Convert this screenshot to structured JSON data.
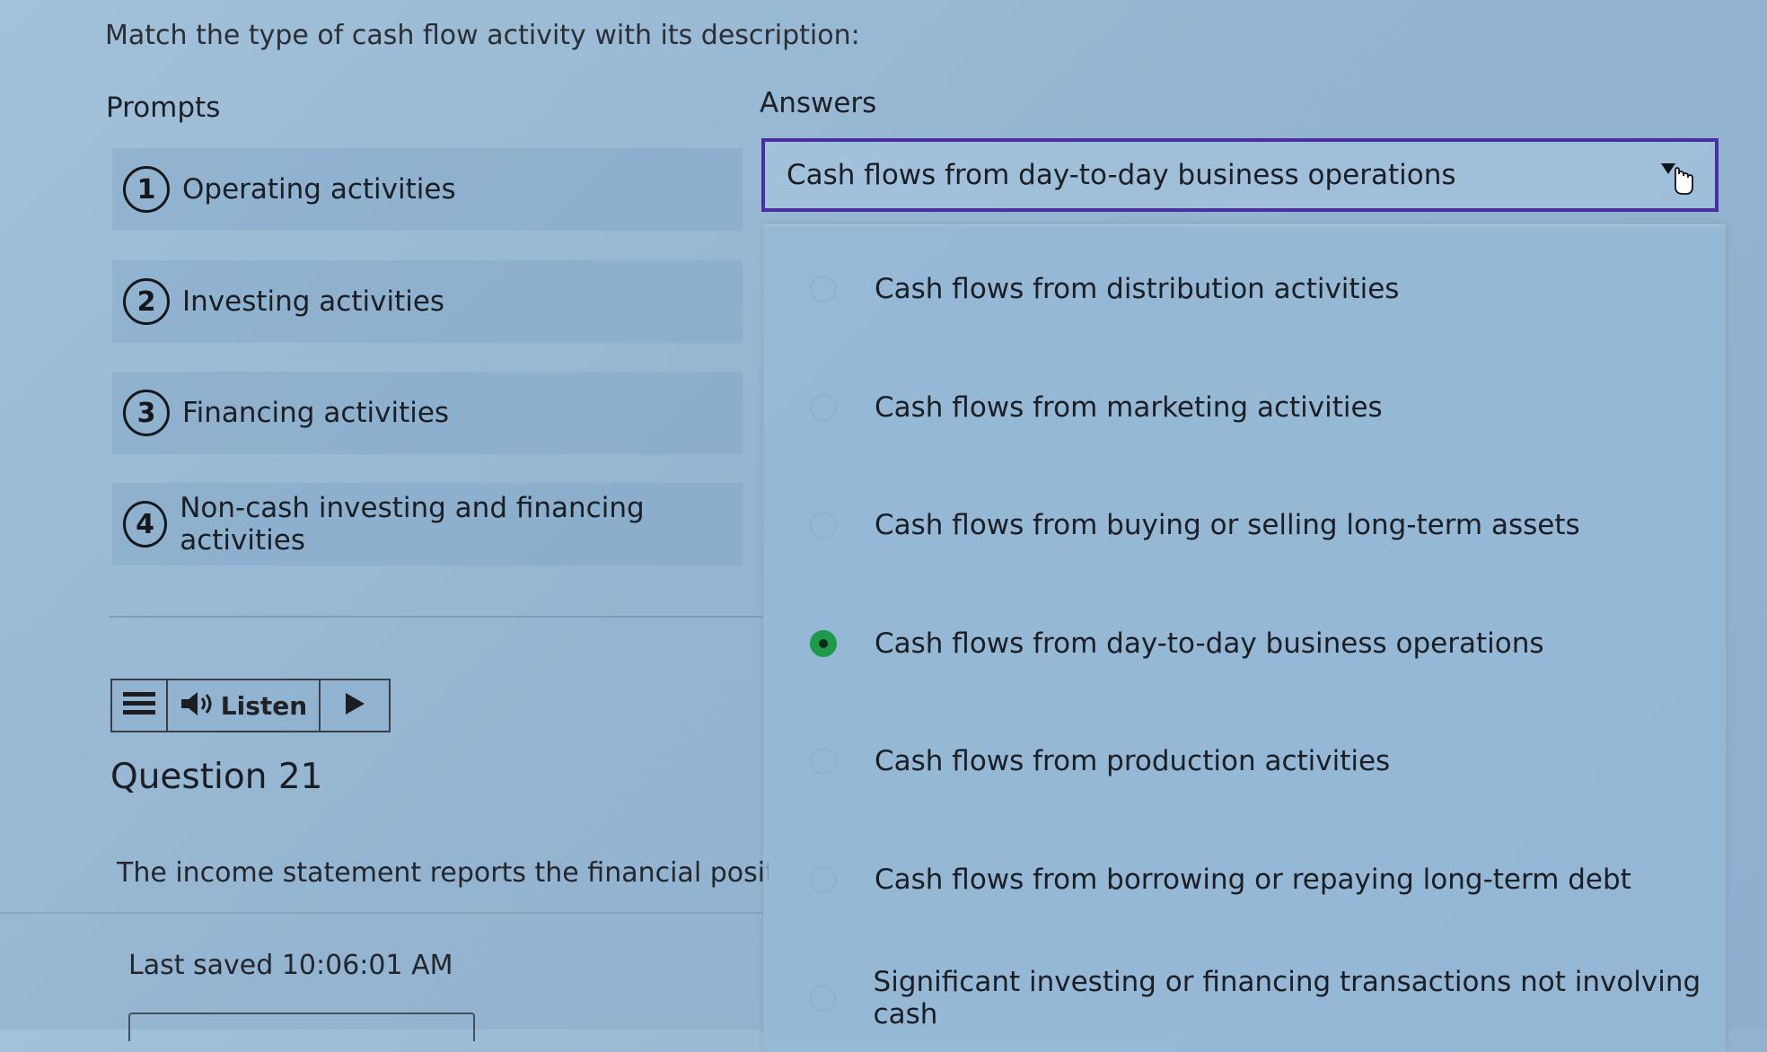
{
  "instruction": "Match the type of cash flow activity with its description:",
  "prompts_heading": "Prompts",
  "answers_heading": "Answers",
  "prompts": [
    {
      "number": "1",
      "label": "Operating activities"
    },
    {
      "number": "2",
      "label": "Investing activities"
    },
    {
      "number": "3",
      "label": "Financing activities"
    },
    {
      "number": "4",
      "label": "Non-cash investing and financing activities"
    }
  ],
  "select": {
    "value": "Cash flows from day-to-day business operations"
  },
  "options": [
    {
      "label": "Cash flows from distribution activities",
      "selected": false
    },
    {
      "label": "Cash flows from marketing activities",
      "selected": false
    },
    {
      "label": "Cash flows from buying or selling long-term assets",
      "selected": false
    },
    {
      "label": "Cash flows from day-to-day business operations",
      "selected": true
    },
    {
      "label": "Cash flows from production activities",
      "selected": false
    },
    {
      "label": "Cash flows from borrowing or repaying long-term debt",
      "selected": false
    },
    {
      "label": "Significant investing or financing transactions not involving cash",
      "selected": false
    }
  ],
  "listen": {
    "label": "Listen"
  },
  "question": {
    "title": "Question 21",
    "body": "The income statement reports the financial position o"
  },
  "status": {
    "last_saved": "Last saved 10:06:01 AM"
  },
  "icons": {
    "menu": "hamburger-icon",
    "speaker": "speaker-icon",
    "play": "play-icon",
    "caret": "caret-down-icon",
    "cursor": "hand-cursor-icon"
  },
  "colors": {
    "select_border": "#4a2fa0",
    "selected_radio": "#1f9a4a"
  }
}
